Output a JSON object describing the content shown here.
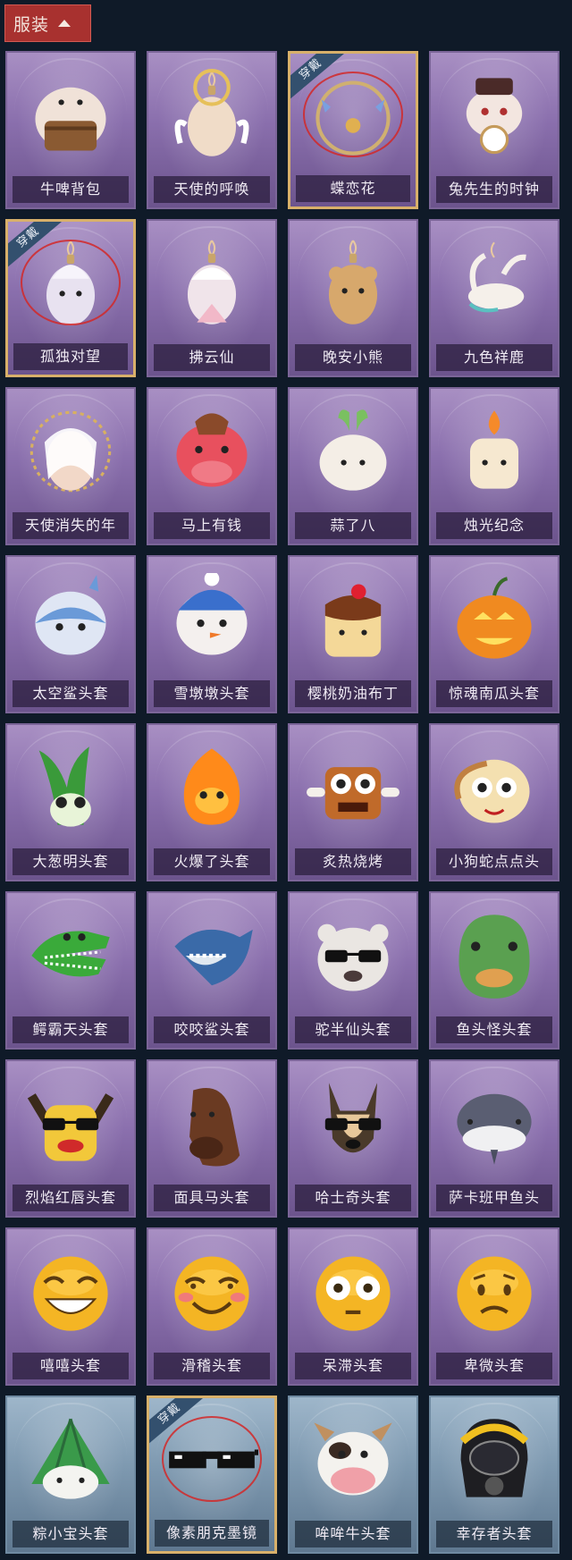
{
  "section": {
    "title": "服装",
    "icon": "caret-up-icon"
  },
  "items": [
    {
      "name": "牛啤背包",
      "equipped": false,
      "bg": "purple",
      "icon": "cow-keg-backpack-icon"
    },
    {
      "name": "天使的呼唤",
      "equipped": false,
      "bg": "purple",
      "icon": "angel-doll-icon"
    },
    {
      "name": "蝶恋花",
      "equipped": true,
      "equip_tag": "穿戴",
      "bg": "purple",
      "icon": "butterfly-bell-wreath-icon"
    },
    {
      "name": "兔先生的时钟",
      "equipped": false,
      "bg": "purple",
      "icon": "rabbit-clock-icon"
    },
    {
      "name": "孤独对望",
      "equipped": true,
      "equip_tag": "穿戴",
      "bg": "purple",
      "icon": "lonely-doll-charm-icon"
    },
    {
      "name": "拂云仙",
      "equipped": false,
      "bg": "purple",
      "icon": "cloud-fairy-charm-icon"
    },
    {
      "name": "晚安小熊",
      "equipped": false,
      "bg": "purple",
      "icon": "goodnight-bear-charm-icon"
    },
    {
      "name": "九色祥鹿",
      "equipped": false,
      "bg": "purple",
      "icon": "nine-color-deer-charm-icon"
    },
    {
      "name": "天使消失的年",
      "equipped": false,
      "bg": "purple",
      "icon": "veiled-angel-head-icon"
    },
    {
      "name": "马上有钱",
      "equipped": false,
      "bg": "purple",
      "icon": "red-horse-head-icon"
    },
    {
      "name": "蒜了八",
      "equipped": false,
      "bg": "purple",
      "icon": "garlic-head-icon"
    },
    {
      "name": "烛光纪念",
      "equipped": false,
      "bg": "purple",
      "icon": "candle-head-icon"
    },
    {
      "name": "太空鲨头套",
      "equipped": false,
      "bg": "purple",
      "icon": "space-shark-helmet-icon"
    },
    {
      "name": "雪墩墩头套",
      "equipped": false,
      "bg": "purple",
      "icon": "snowman-helmet-icon"
    },
    {
      "name": "樱桃奶油布丁",
      "equipped": false,
      "bg": "purple",
      "icon": "pudding-head-icon"
    },
    {
      "name": "惊魂南瓜头套",
      "equipped": false,
      "bg": "purple",
      "icon": "pumpkin-head-icon"
    },
    {
      "name": "大葱明头套",
      "equipped": false,
      "bg": "purple",
      "icon": "scallion-head-icon"
    },
    {
      "name": "火爆了头套",
      "equipped": false,
      "bg": "purple",
      "icon": "fire-head-icon"
    },
    {
      "name": "炙热烧烤",
      "equipped": false,
      "bg": "purple",
      "icon": "bbq-meat-head-icon"
    },
    {
      "name": "小狗蛇点点头",
      "equipped": false,
      "bg": "purple",
      "icon": "dog-snake-head-icon"
    },
    {
      "name": "鳄霸天头套",
      "equipped": false,
      "bg": "purple",
      "icon": "crocodile-head-icon"
    },
    {
      "name": "咬咬鲨头套",
      "equipped": false,
      "bg": "purple",
      "icon": "biting-shark-head-icon"
    },
    {
      "name": "驼半仙头套",
      "equipped": false,
      "bg": "purple",
      "icon": "alpaca-sunglasses-head-icon"
    },
    {
      "name": "鱼头怪头套",
      "equipped": false,
      "bg": "purple",
      "icon": "fish-monster-head-icon"
    },
    {
      "name": "烈焰红唇头套",
      "equipped": false,
      "bg": "purple",
      "icon": "red-lips-yellow-head-icon"
    },
    {
      "name": "面具马头套",
      "equipped": false,
      "bg": "purple",
      "icon": "horse-mask-icon"
    },
    {
      "name": "哈士奇头套",
      "equipped": false,
      "bg": "purple",
      "icon": "husky-sunglasses-head-icon"
    },
    {
      "name": "萨卡班甲鱼头",
      "equipped": false,
      "bg": "purple",
      "icon": "sacabambaspis-head-icon"
    },
    {
      "name": "嘻嘻头套",
      "equipped": false,
      "bg": "purple",
      "icon": "grinning-emoji-head-icon"
    },
    {
      "name": "滑稽头套",
      "equipped": false,
      "bg": "purple",
      "icon": "funny-emoji-head-icon"
    },
    {
      "name": "呆滞头套",
      "equipped": false,
      "bg": "purple",
      "icon": "dazed-emoji-head-icon"
    },
    {
      "name": "卑微头套",
      "equipped": false,
      "bg": "purple",
      "icon": "humble-emoji-head-icon"
    },
    {
      "name": "粽小宝头套",
      "equipped": false,
      "bg": "blue",
      "icon": "zongzi-head-icon"
    },
    {
      "name": "像素朋克墨镜",
      "equipped": true,
      "equip_tag": "穿戴",
      "bg": "blue",
      "icon": "pixel-sunglasses-icon"
    },
    {
      "name": "哞哞牛头套",
      "equipped": false,
      "bg": "blue",
      "icon": "moo-cow-head-icon"
    },
    {
      "name": "幸存者头套",
      "equipped": false,
      "bg": "blue",
      "icon": "gas-mask-helmet-icon"
    }
  ]
}
